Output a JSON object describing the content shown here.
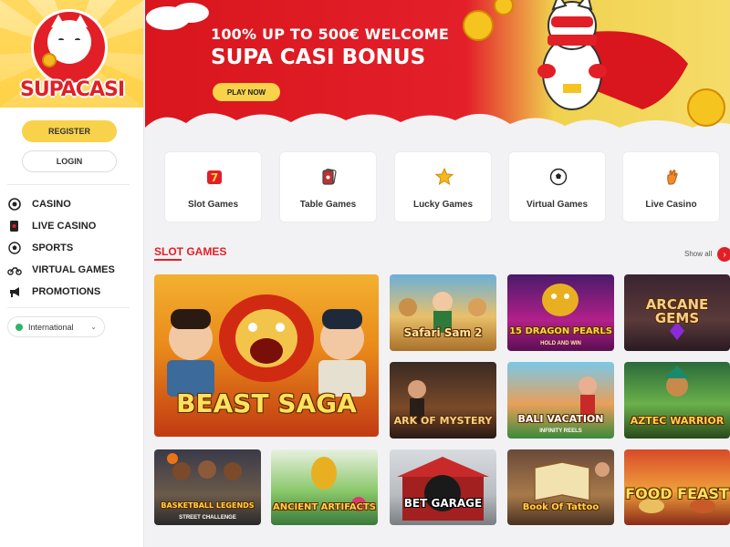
{
  "brand": {
    "name": "SUPACASI"
  },
  "auth": {
    "register_label": "REGISTER",
    "login_label": "LOGIN"
  },
  "nav": {
    "items": [
      {
        "label": "CASINO",
        "icon": "casino-chip-icon"
      },
      {
        "label": "LIVE CASINO",
        "icon": "cards-icon"
      },
      {
        "label": "SPORTS",
        "icon": "soccer-ball-icon"
      },
      {
        "label": "VIRTUAL GAMES",
        "icon": "motorbike-icon"
      },
      {
        "label": "PROMOTIONS",
        "icon": "megaphone-icon"
      }
    ]
  },
  "language": {
    "label": "International"
  },
  "banner": {
    "headline": "100% UP TO 500€ WELCOME",
    "title": "SUPA CASI BONUS",
    "cta_label": "PLAY NOW"
  },
  "categories": [
    {
      "label": "Slot Games",
      "icon": "slot-seven-icon"
    },
    {
      "label": "Table Games",
      "icon": "playing-card-icon"
    },
    {
      "label": "Lucky Games",
      "icon": "star-icon"
    },
    {
      "label": "Virtual Games",
      "icon": "soccer-ball-icon"
    },
    {
      "label": "Live Casino",
      "icon": "hand-icon"
    }
  ],
  "slots_section": {
    "title": "SLOT GAMES",
    "show_all_label": "Show all",
    "games": [
      {
        "title": "BEAST SAGA",
        "subtitle": ""
      },
      {
        "title": "Safari Sam 2",
        "subtitle": ""
      },
      {
        "title": "15 DRAGON PEARLS",
        "subtitle": "HOLD AND WIN"
      },
      {
        "title": "ARCANE GEMS",
        "subtitle": ""
      },
      {
        "title": "ARK OF MYSTERY",
        "subtitle": ""
      },
      {
        "title": "BALI VACATION",
        "subtitle": "INFINITY REELS"
      },
      {
        "title": "AZTEC WARRIOR",
        "subtitle": ""
      },
      {
        "title": "BASKETBALL LEGENDS",
        "subtitle": "STREET CHALLENGE"
      },
      {
        "title": "ANCIENT ARTIFACTS",
        "subtitle": ""
      },
      {
        "title": "BET GARAGE",
        "subtitle": ""
      },
      {
        "title": "Book Of Tattoo",
        "subtitle": ""
      },
      {
        "title": "FOOD FEAST",
        "subtitle": ""
      }
    ]
  },
  "colors": {
    "brand_red": "#e21f26",
    "brand_yellow": "#f8d24a"
  }
}
